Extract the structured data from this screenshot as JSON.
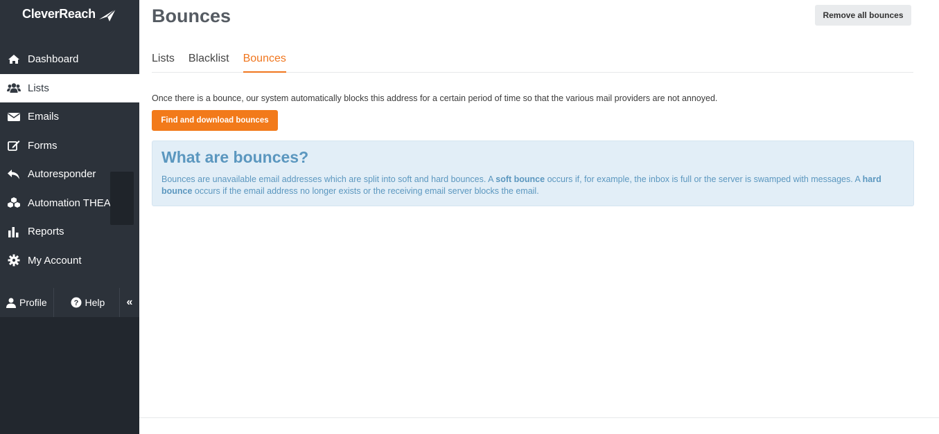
{
  "app": {
    "logo_text": "CleverReach"
  },
  "sidebar": {
    "items": [
      {
        "label": "Dashboard",
        "icon": "home-icon"
      },
      {
        "label": "Lists",
        "icon": "users-icon",
        "active": true
      },
      {
        "label": "Emails",
        "icon": "envelope-icon"
      },
      {
        "label": "Forms",
        "icon": "edit-icon"
      },
      {
        "label": "Autoresponder",
        "icon": "reply-icon"
      },
      {
        "label": "Automation THEA",
        "icon": "cubes-icon"
      },
      {
        "label": "Reports",
        "icon": "bar-chart-icon"
      },
      {
        "label": "My Account",
        "icon": "gear-icon"
      }
    ],
    "footer": {
      "profile_label": "Profile",
      "help_label": "Help",
      "collapse_glyph": "«"
    }
  },
  "page": {
    "title": "Bounces",
    "remove_all_label": "Remove all bounces",
    "tabs": [
      {
        "label": "Lists"
      },
      {
        "label": "Blacklist"
      },
      {
        "label": "Bounces",
        "active": true
      }
    ],
    "description": "Once there is a bounce, our system automatically blocks this address for a certain period of time so that the various mail providers are not annoyed.",
    "find_download_label": "Find and download bounces",
    "info": {
      "title": "What are bounces?",
      "text_1": "Bounces are unavailable email addresses which are split into soft and hard bounces. A ",
      "bold_1": "soft bounce",
      "text_2": " occurs if, for example, the inbox is full or the server is swamped with messages. A ",
      "bold_2": "hard bounce",
      "text_3": " occurs if the email address no longer exists or the receiving email server blocks the email."
    }
  },
  "colors": {
    "accent": "#f27a1a",
    "sidebar_bg": "#2c323a",
    "info_bg": "#e2eef7",
    "info_text": "#5b97bf"
  }
}
